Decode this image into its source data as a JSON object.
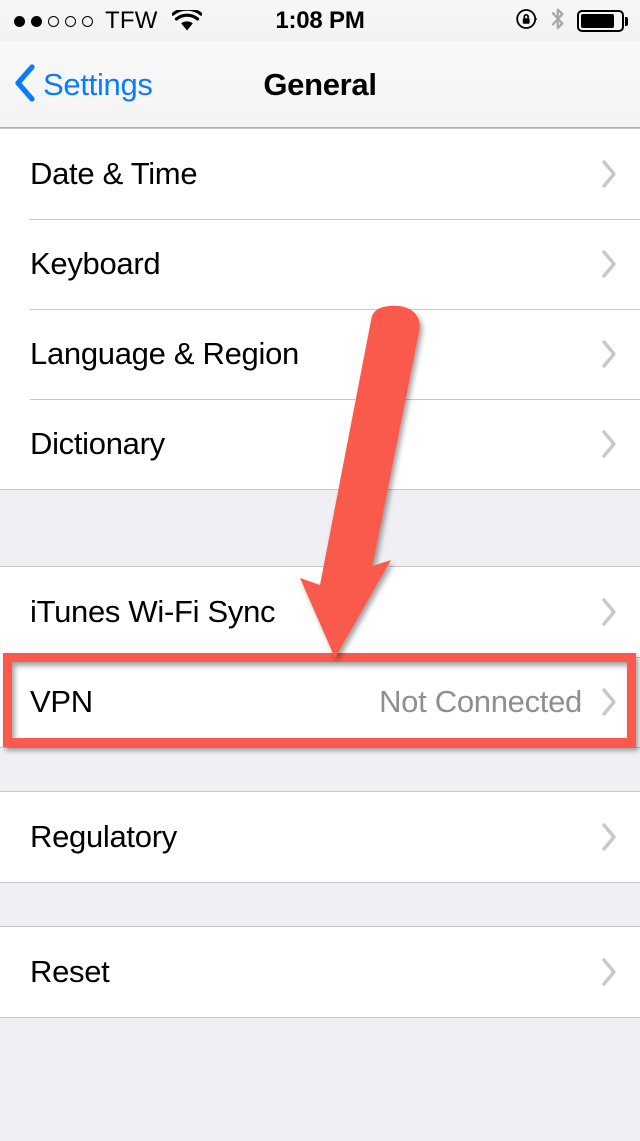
{
  "status_bar": {
    "signal_dots_filled": 2,
    "signal_dots_total": 5,
    "carrier": "TFW",
    "wifi_icon": "wifi-icon",
    "time": "1:08 PM",
    "rotation_lock_icon": "rotation-lock-icon",
    "bluetooth_icon": "bluetooth-icon",
    "battery_icon": "battery-icon",
    "battery_percent": 85
  },
  "nav_bar": {
    "back_label": "Settings",
    "back_icon": "chevron-left-icon",
    "title": "General"
  },
  "colors": {
    "accent_blue": "#0A7CFF",
    "annotation_red": "#FA5A4B",
    "secondary_text": "#8E8E93",
    "chevron_gray": "#C7C7CC",
    "group_background": "#EFEFF4",
    "separator": "#C8C7CC"
  },
  "sections": [
    {
      "rows": [
        {
          "label": "Date & Time",
          "value": "",
          "chevron": "chevron-right-icon",
          "highlighted": false
        },
        {
          "label": "Keyboard",
          "value": "",
          "chevron": "chevron-right-icon",
          "highlighted": false
        },
        {
          "label": "Language & Region",
          "value": "",
          "chevron": "chevron-right-icon",
          "highlighted": false
        },
        {
          "label": "Dictionary",
          "value": "",
          "chevron": "chevron-right-icon",
          "highlighted": false
        }
      ]
    },
    {
      "rows": [
        {
          "label": "iTunes Wi-Fi Sync",
          "value": "",
          "chevron": "chevron-right-icon",
          "highlighted": false
        },
        {
          "label": "VPN",
          "value": "Not Connected",
          "chevron": "chevron-right-icon",
          "highlighted": true
        }
      ]
    },
    {
      "rows": [
        {
          "label": "Regulatory",
          "value": "",
          "chevron": "chevron-right-icon",
          "highlighted": false
        }
      ]
    },
    {
      "rows": [
        {
          "label": "Reset",
          "value": "",
          "chevron": "chevron-right-icon",
          "highlighted": false
        }
      ]
    }
  ],
  "annotations": {
    "arrow": {
      "name": "red-arrow-pointing-to-vpn",
      "color": "#FA5A4B"
    },
    "highlight_box": {
      "name": "red-highlight-box-around-vpn-row",
      "color": "#FA5A4B",
      "target": "VPN"
    }
  }
}
